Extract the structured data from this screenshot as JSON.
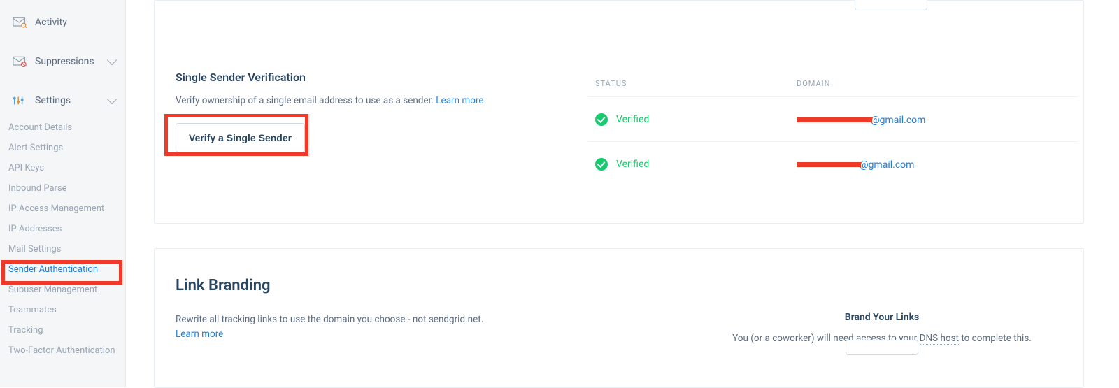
{
  "sidebar": {
    "activity": "Activity",
    "suppressions": "Suppressions",
    "settings": "Settings",
    "subs": [
      {
        "label": "Account Details",
        "active": false
      },
      {
        "label": "Alert Settings",
        "active": false
      },
      {
        "label": "API Keys",
        "active": false
      },
      {
        "label": "Inbound Parse",
        "active": false
      },
      {
        "label": "IP Access Management",
        "active": false
      },
      {
        "label": "IP Addresses",
        "active": false
      },
      {
        "label": "Mail Settings",
        "active": false
      },
      {
        "label": "Sender Authentication",
        "active": true
      },
      {
        "label": "Subuser Management",
        "active": false
      },
      {
        "label": "Teammates",
        "active": false
      },
      {
        "label": "Tracking",
        "active": false
      },
      {
        "label": "Two-Factor Authentication",
        "active": false
      }
    ]
  },
  "ssv": {
    "title": "Single Sender Verification",
    "desc": "Verify ownership of a single email address to use as a sender. ",
    "learn": "Learn more",
    "button": "Verify a Single Sender",
    "head_status": "STATUS",
    "head_domain": "DOMAIN",
    "rows": [
      {
        "status": "Verified",
        "redact_w": 108,
        "suffix": "@gmail.com"
      },
      {
        "status": "Verified",
        "redact_w": 92,
        "suffix": "@gmail.com"
      }
    ]
  },
  "lb": {
    "title": "Link Branding",
    "desc": "Rewrite all tracking links to use the domain you choose - not sendgrid.net.",
    "learn": "Learn more",
    "subtitle": "Brand Your Links",
    "note_pre": "You (or a coworker) will need access to your ",
    "note_dns": "DNS host",
    "note_post": " to complete this."
  }
}
